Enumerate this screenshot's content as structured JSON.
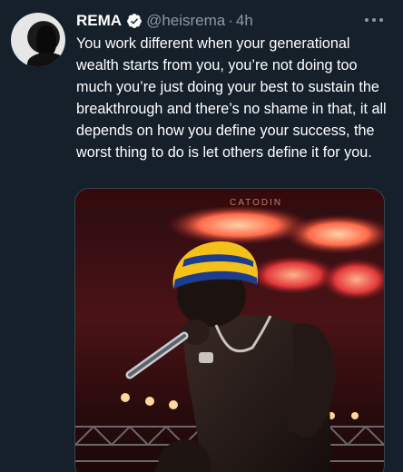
{
  "tweet": {
    "author_name": "REMA",
    "handle": "@heisrema",
    "separator": "·",
    "time": "4h",
    "text": "You work different when your generational wealth starts from you, you’re not doing too much you’re just doing your best to sustain the breakthrough and there’s no shame in that, it all depends on how you define your success, the worst thing to do is let others define it for you.",
    "media_banner_text": "CATODIN"
  },
  "icons": {
    "avatar": "profile-photo",
    "verified": "verified-badge-icon",
    "more": "more-options-icon"
  },
  "colors": {
    "background": "#15202b",
    "text_primary": "#ffffff",
    "text_secondary": "#8b98a5",
    "border": "#38444d"
  }
}
